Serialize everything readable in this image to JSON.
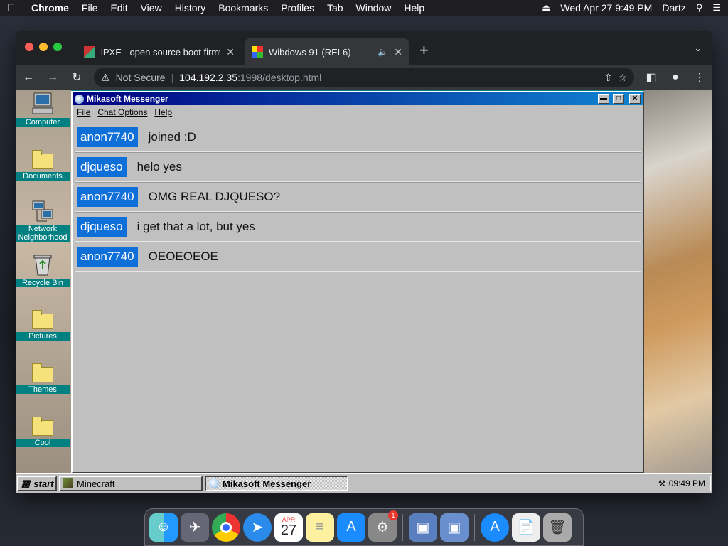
{
  "mac_menubar": {
    "app": "Chrome",
    "items": [
      "File",
      "Edit",
      "View",
      "History",
      "Bookmarks",
      "Profiles",
      "Tab",
      "Window",
      "Help"
    ],
    "datetime": "Wed Apr 27  9:49 PM",
    "user": "Dartz"
  },
  "browser": {
    "tabs": [
      {
        "title": "iPXE - open source boot firmw",
        "active": false
      },
      {
        "title": "Wibdows 91 (REL6)",
        "active": true
      }
    ],
    "omnibox": {
      "security": "Not Secure",
      "host": "104.192.2.35",
      "path": ":1998/desktop.html"
    }
  },
  "desktop": {
    "icons": [
      {
        "label": "Computer",
        "icon": "computer-icon"
      },
      {
        "label": "Documents",
        "icon": "documents-folder-icon"
      },
      {
        "label": "Network Neighborhood",
        "icon": "network-icon"
      },
      {
        "label": "Recycle Bin",
        "icon": "recycle-bin-icon"
      },
      {
        "label": "Pictures",
        "icon": "folder-icon"
      },
      {
        "label": "Themes",
        "icon": "folder-icon"
      },
      {
        "label": "Cool",
        "icon": "folder-icon"
      }
    ]
  },
  "messenger": {
    "title": "Mikasoft Messenger",
    "menu": [
      "File",
      "Chat Options",
      "Help"
    ],
    "messages": [
      {
        "user": "anon7740",
        "text": "joined :D"
      },
      {
        "user": "djqueso",
        "text": "helo yes"
      },
      {
        "user": "anon7740",
        "text": "OMG REAL DJQUESO?"
      },
      {
        "user": "djqueso",
        "text": "i get that a lot, but yes"
      },
      {
        "user": "anon7740",
        "text": "OEOEOEOE"
      }
    ]
  },
  "taskbar": {
    "start": "start",
    "tasks": [
      "Minecraft",
      "Mikasoft Messenger"
    ],
    "clock": "09:49 PM"
  },
  "dock": {
    "apps": [
      "finder-icon",
      "launchpad-icon",
      "chrome-icon",
      "safari-icon",
      "calendar-icon",
      "notes-icon",
      "app-store-icon",
      "system-preferences-icon",
      "virtualbox-icon",
      "virtualbox-vm-icon",
      "app-store-downloads-icon",
      "document-icon",
      "trash-icon"
    ],
    "calendar": {
      "month": "APR",
      "day": "27"
    },
    "badge": "1"
  },
  "colors": {
    "title_bar_start": "#000080",
    "title_bar_end": "#1084d0",
    "username_bg": "#0f6fd9",
    "desktop_teal": "#008080"
  }
}
